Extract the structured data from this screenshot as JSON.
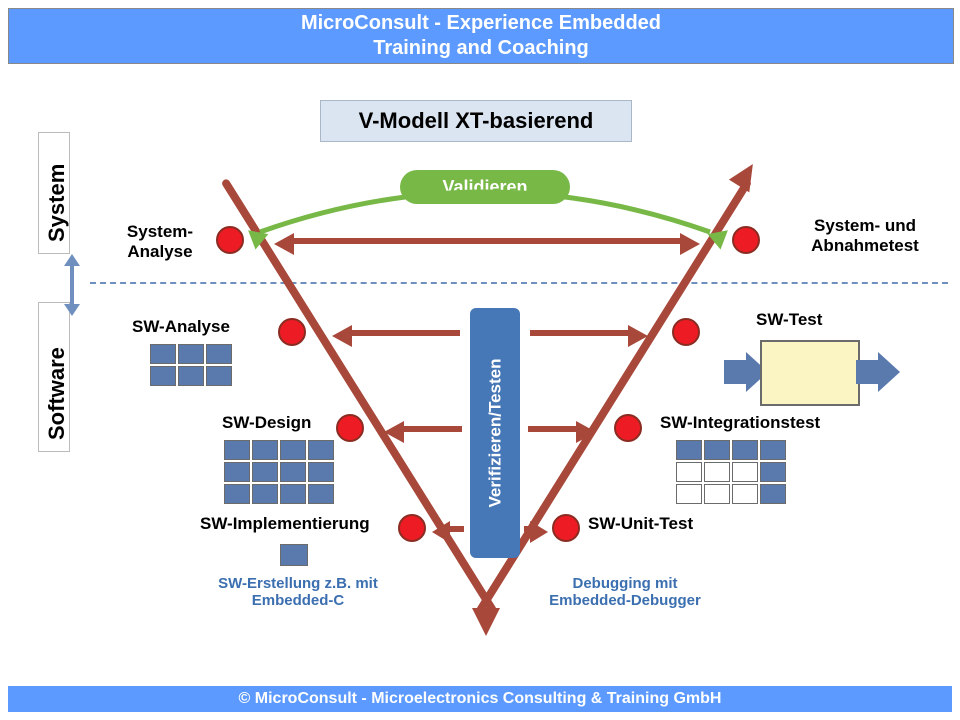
{
  "header": {
    "line1": "MicroConsult  - Experience Embedded",
    "line2": "Training and Coaching"
  },
  "footer": "© MicroConsult - Microelectronics Consulting & Training GmbH",
  "title": "V-Modell XT-basierend",
  "axis": {
    "system": "System",
    "software": "Software"
  },
  "validate": "Validieren",
  "verify": "Verifizieren/Testen",
  "left": {
    "n1": "System-\nAnalyse",
    "n2": "SW-Analyse",
    "n3": "SW-Design",
    "n4": "SW-Implementierung"
  },
  "right": {
    "n1": "System- und Abnahmetest",
    "n2": "SW-Test",
    "n3": "SW-Integrationstest",
    "n4": "SW-Unit-Test"
  },
  "captions": {
    "left": "SW-Erstellung z.B. mit Embedded-C",
    "right": "Debugging mit Embedded-Debugger"
  }
}
